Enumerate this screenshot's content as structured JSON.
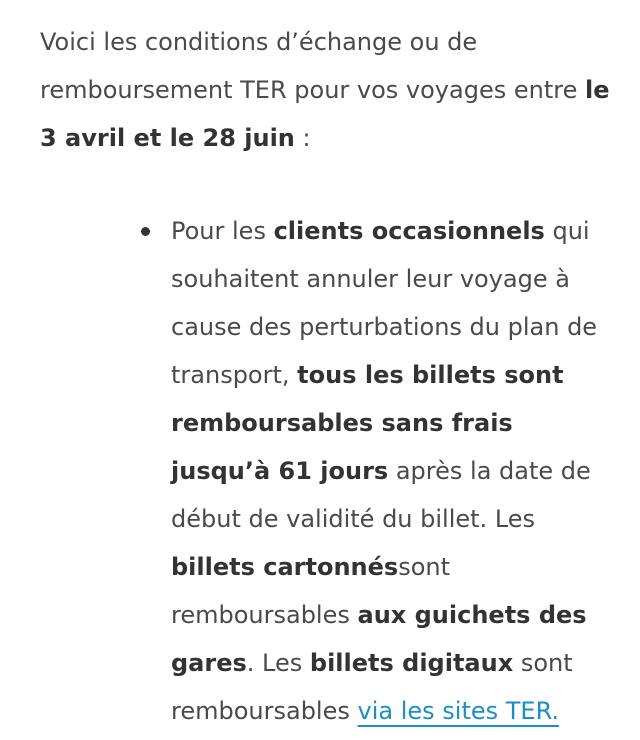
{
  "intro": {
    "text_1": "Voici les conditions d’échange ou de remboursement TER pour vos voyages entre ",
    "dates_bold": "le 3 avril et le 28 juin",
    "text_2": " :"
  },
  "bullet": {
    "t1": "Pour les ",
    "b1": "clients occasionnels",
    "t2": " qui souhaitent annuler leur voyage à cause des perturbations du plan de transport, ",
    "b2": "tous les billets sont remboursables sans frais jusqu’à 61 jours",
    "t3": " après la date de début de validité du billet. Les ",
    "b3": "billets cartonnés",
    "t4": "sont remboursables ",
    "b4": "aux guichets des gares",
    "t5": ". Les ",
    "b5": "billets digitaux",
    "t6": " sont remboursables ",
    "link": "via les sites TER."
  }
}
